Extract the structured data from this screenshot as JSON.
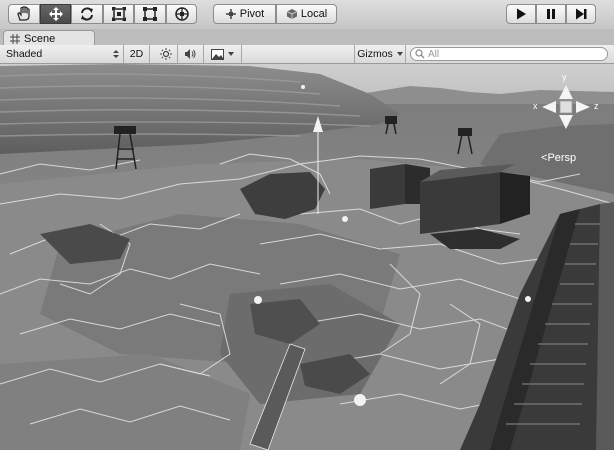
{
  "toolbar": {
    "tools": [
      {
        "name": "hand-icon"
      },
      {
        "name": "move-icon",
        "active": true
      },
      {
        "name": "rotate-icon"
      },
      {
        "name": "scale-icon"
      },
      {
        "name": "rect-icon"
      },
      {
        "name": "transform-icon"
      }
    ],
    "pivot_label": "Pivot",
    "local_label": "Local",
    "play": {
      "play_icon": "play-icon",
      "pause_icon": "pause-icon",
      "step_icon": "step-icon"
    }
  },
  "tabs": [
    {
      "label": "Scene"
    }
  ],
  "scene_toolbar": {
    "shading_mode": "Shaded",
    "mode_2d": "2D",
    "gizmos_label": "Gizmos",
    "search_placeholder": "All"
  },
  "viewport": {
    "camera_label": "Persp",
    "gizmo_axes": {
      "y": "y",
      "x": "x",
      "z": "z"
    }
  }
}
